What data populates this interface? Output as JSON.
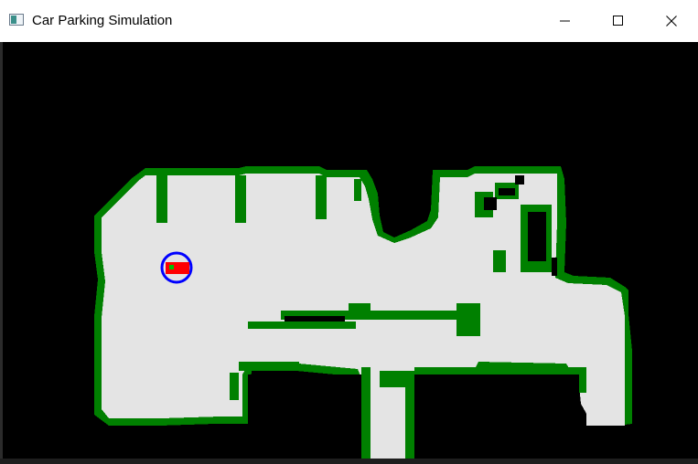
{
  "window": {
    "title": "Car Parking Simulation",
    "controls": {
      "minimize": "minimize",
      "maximize": "maximize",
      "close": "close"
    }
  },
  "colors": {
    "background": "#000000",
    "floor": "#e4e4e4",
    "wall": "#008000",
    "car_body": "#ff0000",
    "car_ring": "#0000ff",
    "car_marker": "#00c000"
  },
  "icons": {
    "app": "app-window-icon",
    "minimize": "minimize-icon",
    "maximize": "maximize-icon",
    "close": "close-icon"
  }
}
